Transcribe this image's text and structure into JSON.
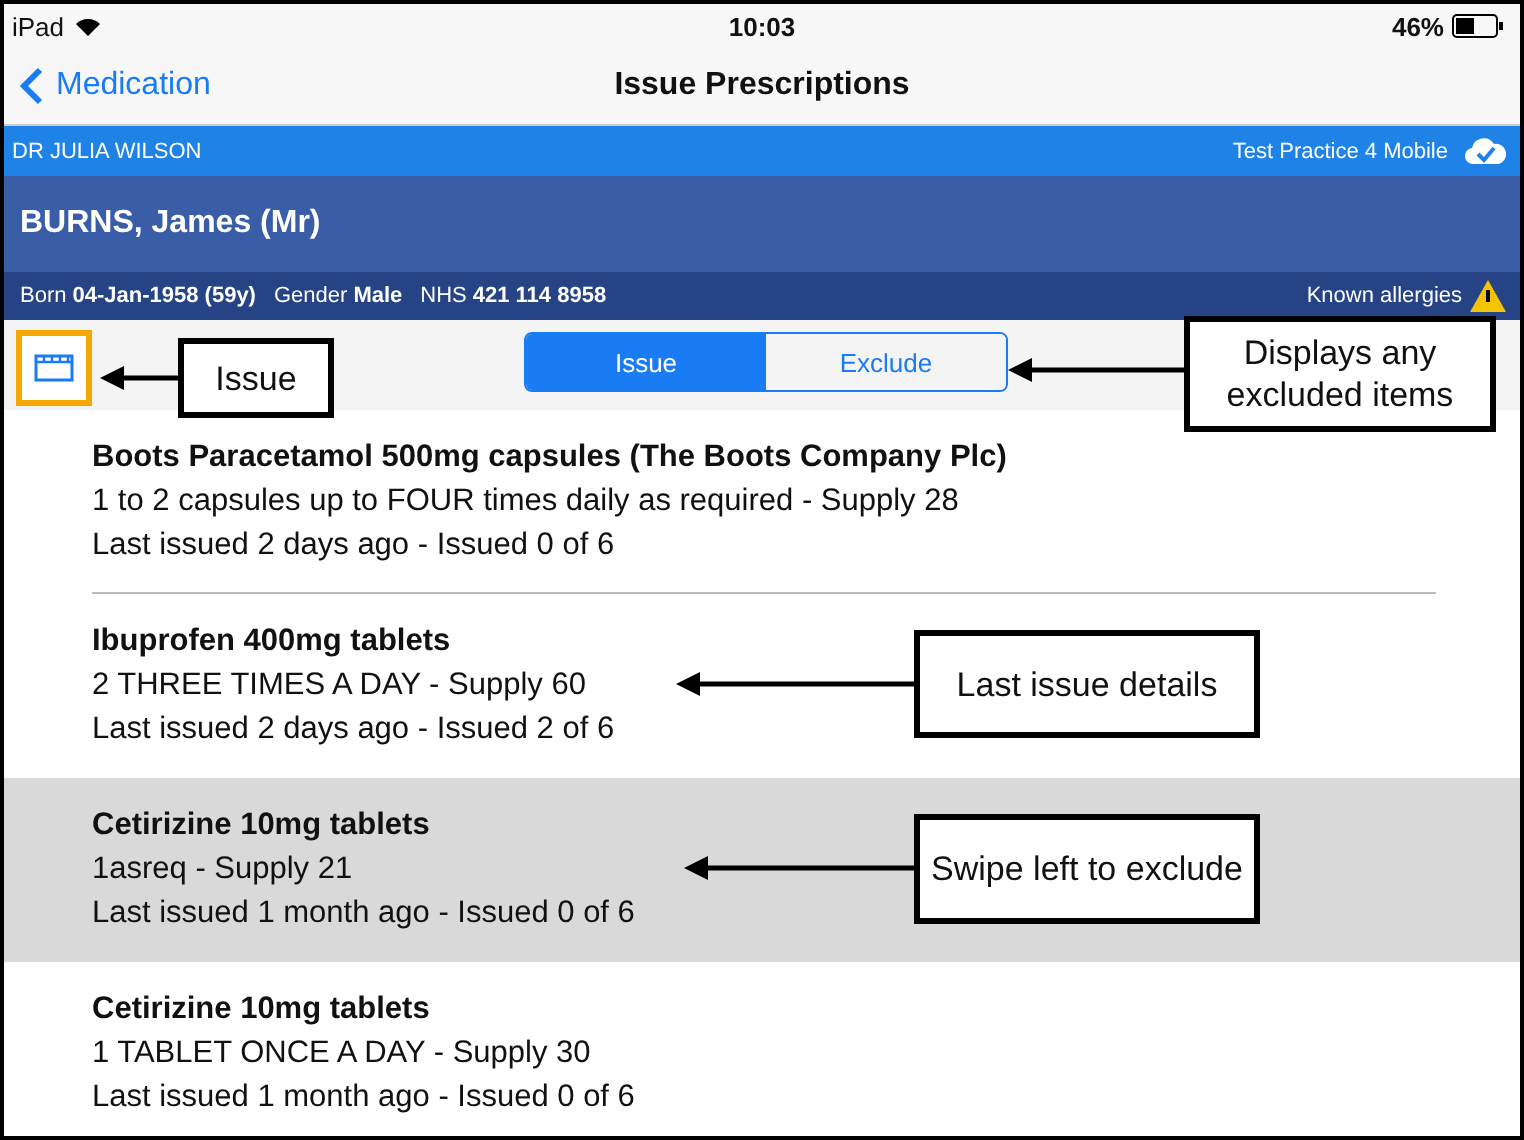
{
  "status_bar": {
    "device": "iPad",
    "time": "10:03",
    "battery": "46%"
  },
  "nav": {
    "back": "Medication",
    "title": "Issue Prescriptions"
  },
  "user_bar": {
    "clinician": "DR JULIA WILSON",
    "practice": "Test Practice 4 Mobile"
  },
  "patient": {
    "name": "BURNS, James (Mr)",
    "born_label": "Born",
    "born": "04-Jan-1958 (59y)",
    "gender_label": "Gender",
    "gender": "Male",
    "nhs_label": "NHS",
    "nhs": "421 114 8958",
    "allergies": "Known allergies"
  },
  "segments": [
    {
      "label": "Issue",
      "selected": true
    },
    {
      "label": "Exclude",
      "selected": false
    }
  ],
  "items": [
    {
      "name": "Boots Paracetamol 500mg capsules (The Boots Company Plc)",
      "dosage": "1 to 2 capsules up to FOUR times daily as required - Supply 28",
      "last_issued": "Last issued 2 days ago - Issued 0 of 6",
      "highlighted": false
    },
    {
      "name": "Ibuprofen 400mg tablets",
      "dosage": "2 THREE TIMES A DAY - Supply 60",
      "last_issued": "Last issued 2 days ago - Issued 2 of 6",
      "highlighted": false
    },
    {
      "name": "Cetirizine 10mg tablets",
      "dosage": "1asreq - Supply 21",
      "last_issued": "Last issued 1 month ago - Issued 0 of 6",
      "highlighted": true
    },
    {
      "name": "Cetirizine 10mg tablets",
      "dosage": "1 TABLET ONCE A DAY - Supply 30",
      "last_issued": "Last issued 1 month ago - Issued 0 of 6",
      "highlighted": false
    }
  ],
  "annotations": [
    {
      "text": "Issue"
    },
    {
      "text": "Displays any excluded items"
    },
    {
      "text": "Last issue details"
    },
    {
      "text": "Swipe left to exclude"
    }
  ]
}
